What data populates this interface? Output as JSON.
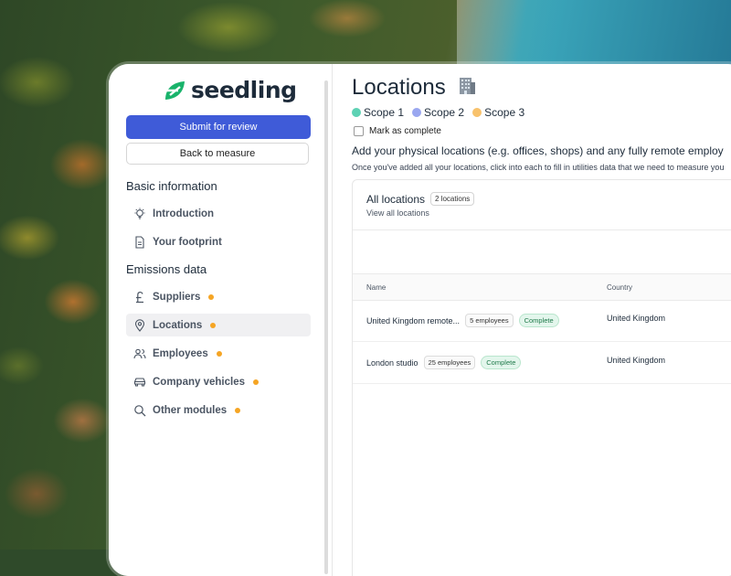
{
  "brand": {
    "name": "seedling"
  },
  "sidebar": {
    "submit_label": "Submit for review",
    "back_label": "Back to measure",
    "section_basic": "Basic information",
    "basic_items": [
      {
        "label": "Introduction",
        "icon": "lightbulb-icon"
      },
      {
        "label": "Your footprint",
        "icon": "document-icon"
      }
    ],
    "section_emissions": "Emissions data",
    "emission_items": [
      {
        "label": "Suppliers",
        "icon": "pound-icon",
        "dot": true
      },
      {
        "label": "Locations",
        "icon": "location-pin-icon",
        "dot": true,
        "active": true
      },
      {
        "label": "Employees",
        "icon": "people-icon",
        "dot": true
      },
      {
        "label": "Company vehicles",
        "icon": "car-icon",
        "dot": true
      },
      {
        "label": "Other modules",
        "icon": "search-icon",
        "dot": true
      }
    ]
  },
  "main": {
    "title": "Locations",
    "title_icon": "building-icon",
    "scopes": [
      {
        "label": "Scope 1",
        "color": "#5ed2b4"
      },
      {
        "label": "Scope 2",
        "color": "#9aa7f0"
      },
      {
        "label": "Scope 3",
        "color": "#f8c26c"
      }
    ],
    "mark_complete_label": "Mark as complete",
    "heading": "Add your physical locations (e.g. offices, shops) and any fully remote employ",
    "subtext": "Once you've added all your locations, click into each to fill in utilities data that we need to measure you",
    "panel": {
      "title": "All locations",
      "count_badge": "2 locations",
      "view_all": "View all locations",
      "columns": [
        "Name",
        "Country"
      ],
      "rows": [
        {
          "name": "United Kingdom remote...",
          "employees": "5 employees",
          "status": "Complete",
          "country": "United Kingdom"
        },
        {
          "name": "London studio",
          "employees": "25 employees",
          "status": "Complete",
          "country": "United Kingdom"
        }
      ]
    }
  },
  "colors": {
    "primary": "#3f5bd8",
    "accent_dot": "#f5a524",
    "logo_green": "#19b36b"
  }
}
